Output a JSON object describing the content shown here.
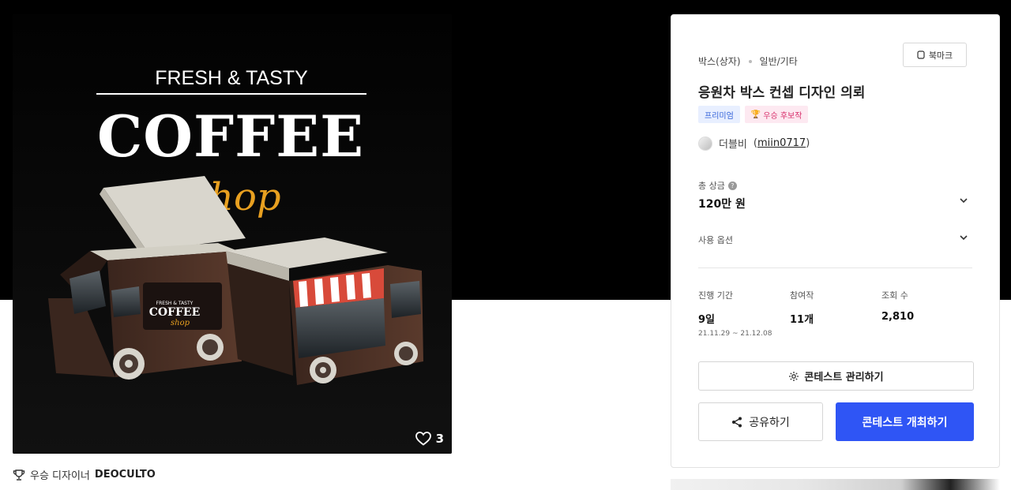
{
  "hero": {
    "image": {
      "headline_top": "FRESH & TASTY",
      "headline_main": "COFFEE",
      "headline_script": "shop",
      "truck_label_top": "FRESH & TASTY",
      "truck_label_main": "COFFEE",
      "truck_label_script": "shop"
    },
    "like_icon": "heart-icon",
    "like_count": "3"
  },
  "winner_line": {
    "icon": "trophy-icon",
    "prefix": "우승 디자이너",
    "name": "DEOCULTO"
  },
  "panel": {
    "breadcrumb": [
      "박스(상자)",
      "일반/기타"
    ],
    "bookmark_label": "북마크",
    "title": "응원차 박스 컨셉 디자인 의뢰",
    "badges": {
      "premium": "프리미엄",
      "winner": "우승 후보작"
    },
    "author": {
      "name": "더블비",
      "handle": "miin0717"
    },
    "prize": {
      "label": "총 상금",
      "value": "120만 원"
    },
    "options_label": "사용 옵션",
    "stats": {
      "period": {
        "label": "진행 기간",
        "value": "9일",
        "range": "21.11.29 ~ 21.12.08"
      },
      "entries": {
        "label": "참여작",
        "value": "11개"
      },
      "views": {
        "label": "조회 수",
        "value": "2,810"
      }
    },
    "manage_label": "콘테스트 관리하기",
    "share_label": "공유하기",
    "host_label": "콘테스트 개최하기",
    "colors": {
      "primary": "#2f55f5",
      "premium_text": "#2f5fd8",
      "winner_text": "#d8306c",
      "truck_brown": "#4a2f25",
      "script_orange": "#e8a020"
    }
  }
}
